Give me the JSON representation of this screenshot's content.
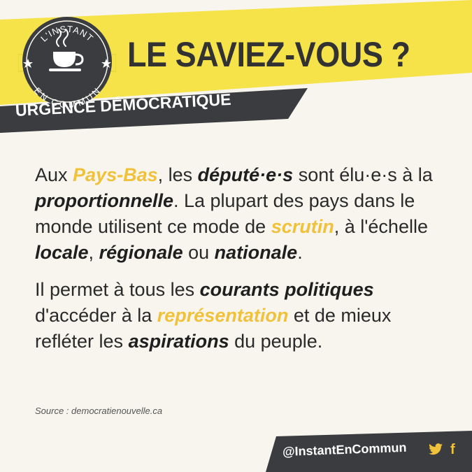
{
  "header": {
    "logo_top": "L'INSTANT",
    "logo_bottom": "EN COMMUN",
    "headline": "LE SAVIEZ-VOUS ?",
    "subtitle": "URGENCE DÉMOCRATIQUE"
  },
  "paragraphs": [
    [
      {
        "t": "Aux ",
        "s": "plain"
      },
      {
        "t": "Pays-Bas",
        "s": "yellow"
      },
      {
        "t": ", les ",
        "s": "plain"
      },
      {
        "t": "député·e·s",
        "s": "bold"
      },
      {
        "t": " sont élu·e·s à la ",
        "s": "plain"
      },
      {
        "t": "proportionnelle",
        "s": "bold"
      },
      {
        "t": ". La plupart des pays dans le monde utilisent ce mode de ",
        "s": "plain"
      },
      {
        "t": "scrutin",
        "s": "yellow"
      },
      {
        "t": ", à l'échelle ",
        "s": "plain"
      },
      {
        "t": "locale",
        "s": "bold"
      },
      {
        "t": ", ",
        "s": "plain"
      },
      {
        "t": "régionale",
        "s": "bold"
      },
      {
        "t": " ou ",
        "s": "plain"
      },
      {
        "t": "nationale",
        "s": "bold"
      },
      {
        "t": ".",
        "s": "plain"
      }
    ],
    [
      {
        "t": "Il permet à tous les ",
        "s": "plain"
      },
      {
        "t": "courants politiques",
        "s": "bold"
      },
      {
        "t": " d'accéder à la ",
        "s": "plain"
      },
      {
        "t": "représentation",
        "s": "yellow"
      },
      {
        "t": " et de mieux refléter les ",
        "s": "plain"
      },
      {
        "t": "aspirations",
        "s": "bold"
      },
      {
        "t": " du peuple.",
        "s": "plain"
      }
    ]
  ],
  "source": "Source : democratienouvelle.ca",
  "footer": {
    "handle": "@InstantEnCommun",
    "facebook_glyph": "f",
    "icons": [
      "twitter-icon",
      "facebook-icon"
    ]
  },
  "colors": {
    "accent_yellow": "#f0c23c",
    "banner_yellow": "#f6e34a",
    "dark": "#3a3c3f",
    "background": "#f7f5ee"
  }
}
